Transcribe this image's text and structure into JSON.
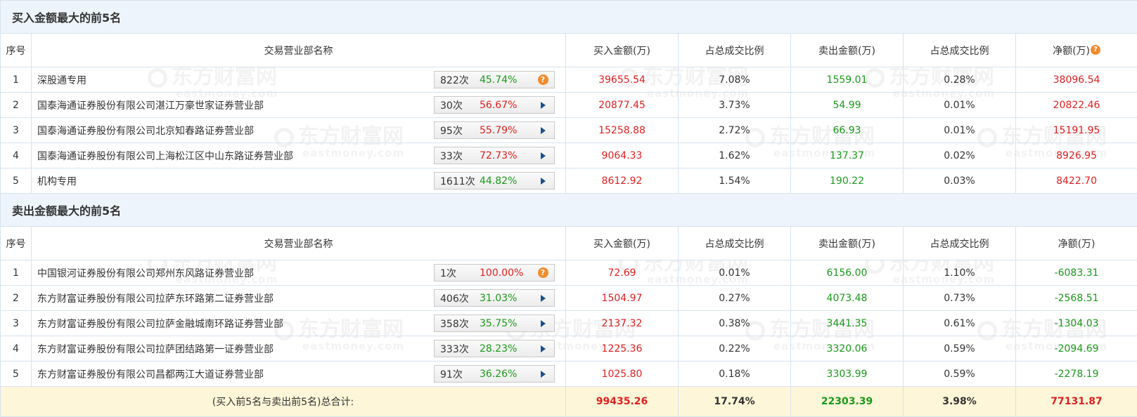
{
  "buy_section": {
    "title": "买入金额最大的前5名",
    "headers": [
      "序号",
      "交易营业部名称",
      "买入金额(万)",
      "占总成交比例",
      "卖出金额(万)",
      "占总成交比例",
      "净额(万)"
    ],
    "net_help_icon": "?",
    "rows": [
      {
        "rank": "1",
        "name": "深股通专用",
        "count": "822次",
        "pct": "45.74%",
        "pct_color": "green",
        "action": "help-icon",
        "buy": "39655.54",
        "buy_ratio": "7.08%",
        "sell": "1559.01",
        "sell_ratio": "0.28%",
        "net": "38096.54",
        "net_color": "red"
      },
      {
        "rank": "2",
        "name": "国泰海通证券股份有限公司湛江万豪世家证券营业部",
        "count": "30次",
        "pct": "56.67%",
        "pct_color": "red",
        "action": "arrow-right-icon",
        "buy": "20877.45",
        "buy_ratio": "3.73%",
        "sell": "54.99",
        "sell_ratio": "0.01%",
        "net": "20822.46",
        "net_color": "red"
      },
      {
        "rank": "3",
        "name": "国泰海通证券股份有限公司北京知春路证券营业部",
        "count": "95次",
        "pct": "55.79%",
        "pct_color": "red",
        "action": "arrow-right-icon",
        "buy": "15258.88",
        "buy_ratio": "2.72%",
        "sell": "66.93",
        "sell_ratio": "0.01%",
        "net": "15191.95",
        "net_color": "red"
      },
      {
        "rank": "4",
        "name": "国泰海通证券股份有限公司上海松江区中山东路证券营业部",
        "count": "33次",
        "pct": "72.73%",
        "pct_color": "red",
        "action": "arrow-right-icon",
        "buy": "9064.33",
        "buy_ratio": "1.62%",
        "sell": "137.37",
        "sell_ratio": "0.02%",
        "net": "8926.95",
        "net_color": "red"
      },
      {
        "rank": "5",
        "name": "机构专用",
        "count": "1611次",
        "pct": "44.82%",
        "pct_color": "green",
        "action": "arrow-right-icon",
        "buy": "8612.92",
        "buy_ratio": "1.54%",
        "sell": "190.22",
        "sell_ratio": "0.03%",
        "net": "8422.70",
        "net_color": "red"
      }
    ]
  },
  "sell_section": {
    "title": "卖出金额最大的前5名",
    "headers": [
      "序号",
      "交易营业部名称",
      "买入金额(万)",
      "占总成交比例",
      "卖出金额(万)",
      "占总成交比例",
      "净额(万)"
    ],
    "rows": [
      {
        "rank": "1",
        "name": "中国银河证券股份有限公司郑州东风路证券营业部",
        "count": "1次",
        "pct": "100.00%",
        "pct_color": "red",
        "action": "help-icon",
        "buy": "72.69",
        "buy_ratio": "0.01%",
        "sell": "6156.00",
        "sell_ratio": "1.10%",
        "net": "-6083.31",
        "net_color": "green"
      },
      {
        "rank": "2",
        "name": "东方财富证券股份有限公司拉萨东环路第二证券营业部",
        "count": "406次",
        "pct": "31.03%",
        "pct_color": "green",
        "action": "arrow-right-icon",
        "buy": "1504.97",
        "buy_ratio": "0.27%",
        "sell": "4073.48",
        "sell_ratio": "0.73%",
        "net": "-2568.51",
        "net_color": "green"
      },
      {
        "rank": "3",
        "name": "东方财富证券股份有限公司拉萨金融城南环路证券营业部",
        "count": "358次",
        "pct": "35.75%",
        "pct_color": "green",
        "action": "arrow-right-icon",
        "buy": "2137.32",
        "buy_ratio": "0.38%",
        "sell": "3441.35",
        "sell_ratio": "0.61%",
        "net": "-1304.03",
        "net_color": "green"
      },
      {
        "rank": "4",
        "name": "东方财富证券股份有限公司拉萨团结路第一证券营业部",
        "count": "333次",
        "pct": "28.23%",
        "pct_color": "green",
        "action": "arrow-right-icon",
        "buy": "1225.36",
        "buy_ratio": "0.22%",
        "sell": "3320.06",
        "sell_ratio": "0.59%",
        "net": "-2094.69",
        "net_color": "green"
      },
      {
        "rank": "5",
        "name": "东方财富证券股份有限公司昌都两江大道证券营业部",
        "count": "91次",
        "pct": "36.26%",
        "pct_color": "green",
        "action": "arrow-right-icon",
        "buy": "1025.80",
        "buy_ratio": "0.18%",
        "sell": "3303.99",
        "sell_ratio": "0.59%",
        "net": "-2278.19",
        "net_color": "green"
      }
    ]
  },
  "total": {
    "label": "(买入前5名与卖出前5名)总合计:",
    "buy": "99435.26",
    "buy_ratio": "17.74%",
    "sell": "22303.39",
    "sell_ratio": "3.98%",
    "net": "77131.87"
  },
  "watermark": {
    "main": "东方财富网",
    "sub": "eastmoney.com"
  },
  "colors": {
    "red": "#e02020",
    "green": "#1a9a1a",
    "section_bg": "#edf4fb",
    "total_bg": "#fdf6d8",
    "border": "#d6e3ef",
    "help_icon": "#f28b2c",
    "arrow": "#1a4f8f"
  }
}
